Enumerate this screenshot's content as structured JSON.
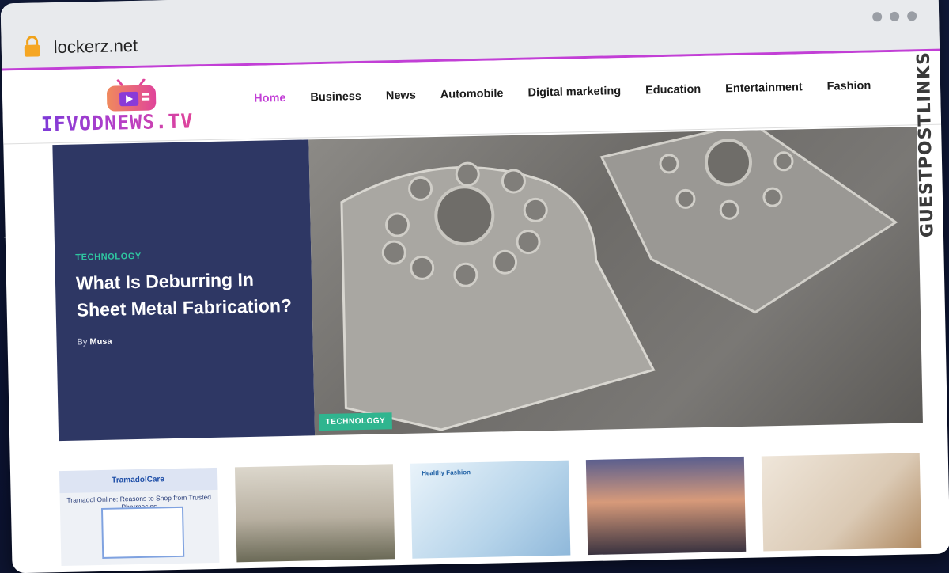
{
  "browser": {
    "url": "lockerz.net"
  },
  "site": {
    "logo_text": "IFVODNEWS.TV",
    "nav": [
      {
        "label": "Home"
      },
      {
        "label": "Business"
      },
      {
        "label": "News"
      },
      {
        "label": "Automobile"
      },
      {
        "label": "Digital marketing"
      },
      {
        "label": "Education"
      },
      {
        "label": "Entertainment"
      },
      {
        "label": "Fashion"
      }
    ]
  },
  "hero": {
    "category": "TECHNOLOGY",
    "title": "What Is Deburring In Sheet Metal Fabrication?",
    "by_prefix": "By",
    "author": "Musa",
    "image_tag": "TECHNOLOGY"
  },
  "cards": {
    "card1_brand": "TramadolCare",
    "card1_caption": "Tramadol Online: Reasons to Shop from Trusted Pharmacies",
    "card3_brand": "Healthy Fashion"
  },
  "badge": {
    "text": "GUESTPOSTLINKS"
  },
  "colors": {
    "accent": "#c23fd6",
    "hero_panel": "#2e3764",
    "category_green": "#2fc6a0"
  }
}
